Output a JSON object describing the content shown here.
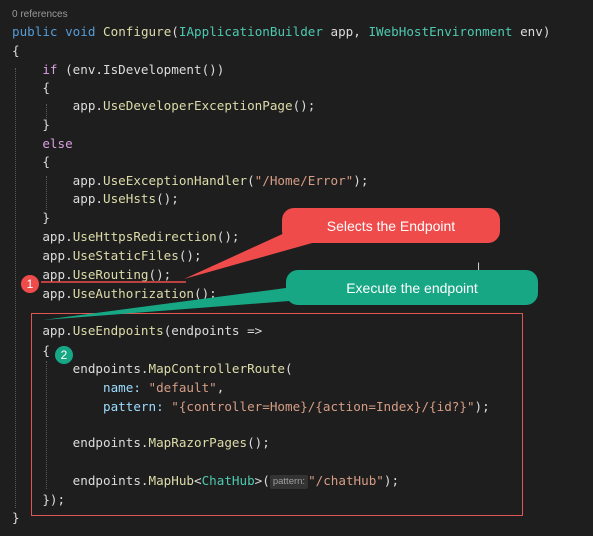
{
  "codelens": "0 references",
  "code": {
    "sig": {
      "kw1": "public",
      "kw2": "void",
      "method": "Configure",
      "p1": "(",
      "t1": "IApplicationBuilder",
      "n1": " app, ",
      "t2": "IWebHostEnvironment",
      "n2": " env)"
    },
    "open_brace": "{",
    "if_kw": "if",
    "if_rest": " (env.IsDevelopment())",
    "obj_app": "app.",
    "dev_page": "UseDeveloperExceptionPage",
    "call_end": "();",
    "close_brace": "}",
    "else_kw": "else",
    "exc_handler": "UseExceptionHandler",
    "exc_arg": "\"/Home/Error\"",
    "exc_end": ");",
    "hsts": "UseHsts",
    "https": "UseHttpsRedirection",
    "static": "UseStaticFiles",
    "routing": "UseRouting",
    "auth": "UseAuthorization",
    "endpoints_call": "UseEndpoints",
    "endpoints_param": "(endpoints =>",
    "obj_ep": "endpoints.",
    "map_ctrl": "MapControllerRoute",
    "open_paren": "(",
    "name_label": "name: ",
    "name_val": "\"default\"",
    "comma": ",",
    "pattern_label": "pattern: ",
    "pattern_val": "\"{controller=Home}/{action=Index}/{id?}\"",
    "razor": "MapRazorPages",
    "map_hub": "MapHub",
    "lt": "<",
    "hub_type": "ChatHub",
    "gt_paren": ">(",
    "hint": "pattern:",
    "hub_arg": "\"/chatHub\"",
    "close_lambda": "});"
  },
  "annotations": {
    "callout1": "Selects the Endpoint",
    "callout2": "Execute the endpoint",
    "badge1": "1",
    "badge2": "2"
  },
  "cursor_glyph": "I",
  "colors": {
    "background": "#1e1e1e",
    "keyword": "#569cd6",
    "control": "#d8a0df",
    "type": "#4ec9b0",
    "method": "#dcdcaa",
    "string": "#d69d85",
    "callout1": "#ef4b4b",
    "callout2": "#17a785",
    "box": "#e05656"
  }
}
